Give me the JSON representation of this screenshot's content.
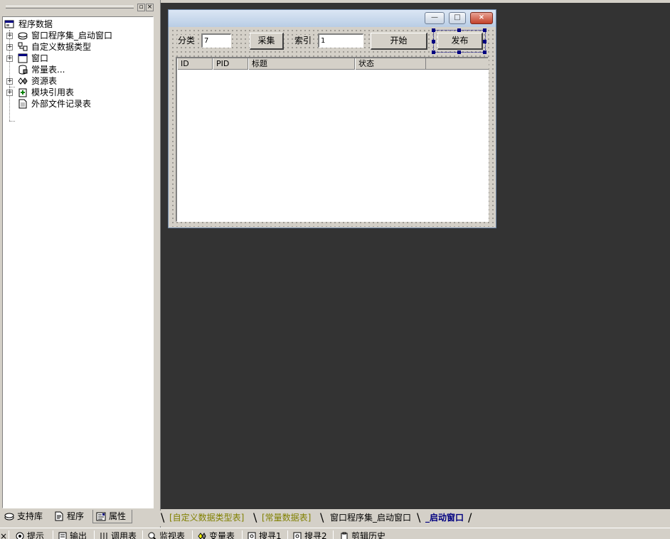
{
  "left_panel": {
    "close_glyph": "×",
    "restore_glyph": "▫",
    "tree": {
      "root": "程序数据",
      "items": [
        {
          "label": "窗口程序集_启动窗口",
          "expander": "+"
        },
        {
          "label": "自定义数据类型",
          "expander": "+"
        },
        {
          "label": "窗口",
          "expander": "+"
        },
        {
          "label": "常量表...",
          "expander": ""
        },
        {
          "label": "资源表",
          "expander": "+"
        },
        {
          "label": "模块引用表",
          "expander": "+"
        },
        {
          "label": "外部文件记录表",
          "expander": ""
        }
      ]
    },
    "tabs": [
      "支持库",
      "程序",
      "属性"
    ]
  },
  "form": {
    "minimize_glyph": "—",
    "maximize_glyph": "□",
    "close_glyph": "×",
    "category_label": "分类",
    "category_value": "7",
    "collect_button": "采集",
    "index_label": "索引",
    "index_value": "1",
    "start_button": "开始",
    "publish_button": "发布",
    "list_columns": [
      "ID",
      "PID",
      "标题",
      "状态"
    ]
  },
  "doc_tabs": [
    {
      "label": "[自定义数据类型表]",
      "color": "#808000"
    },
    {
      "label": "[常量数据表]",
      "color": "#808000"
    },
    {
      "label": "窗口程序集_启动窗口",
      "color": "#000000"
    },
    {
      "label": "_启动窗口",
      "color": "#000080"
    }
  ],
  "bottom_bar": {
    "close_glyph": "×",
    "items": [
      "提示",
      "输出",
      "调用表",
      "监视表",
      "变量表",
      "搜寻1",
      "搜寻2",
      "剪辑历史"
    ]
  },
  "colors": {
    "workspace_bg": "#333333",
    "selection_handle": "#000080",
    "active_tab_text": "#000080",
    "bracket_tab_text": "#808000"
  }
}
